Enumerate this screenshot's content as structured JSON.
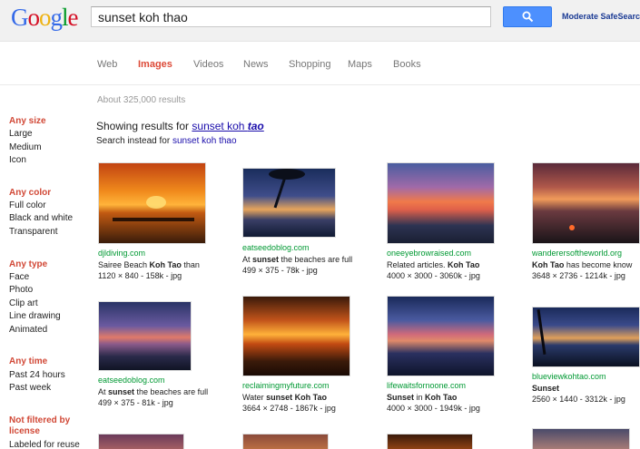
{
  "logo": {
    "letters": [
      "G",
      "o",
      "o",
      "g",
      "l",
      "e"
    ],
    "colors": [
      "#3369e8",
      "#d50f25",
      "#eeb211",
      "#3369e8",
      "#009925",
      "#d50f25"
    ]
  },
  "search": {
    "query": "sunset koh thao"
  },
  "safesearch_label": "Moderate SafeSearch is",
  "tabs": [
    {
      "label": "Web",
      "active": false
    },
    {
      "label": "Images",
      "active": true
    },
    {
      "label": "Videos",
      "active": false
    },
    {
      "label": "News",
      "active": false
    },
    {
      "label": "Shopping",
      "active": false
    },
    {
      "label": "Maps",
      "active": false
    },
    {
      "label": "Books",
      "active": false
    }
  ],
  "result_stats": "About 325,000 results",
  "spelling": {
    "showing_prefix": "Showing results for ",
    "showing_link_a": "sunset koh ",
    "showing_link_b": "tao",
    "instead_prefix": "Search instead for ",
    "instead_link": "sunset koh thao"
  },
  "filters": {
    "size": {
      "heading": "Any size",
      "items": [
        "Large",
        "Medium",
        "Icon"
      ]
    },
    "color": {
      "heading": "Any color",
      "items": [
        "Full color",
        "Black and white",
        "Transparent"
      ]
    },
    "type": {
      "heading": "Any type",
      "items": [
        "Face",
        "Photo",
        "Clip art",
        "Line drawing",
        "Animated"
      ]
    },
    "time": {
      "heading": "Any time",
      "items": [
        "Past 24 hours",
        "Past week"
      ]
    },
    "license": {
      "heading_1": "Not filtered by",
      "heading_2": "license",
      "items": [
        "Labeled for reuse"
      ]
    }
  },
  "results": [
    {
      "cite": "djldiving.com",
      "desc_pre": "Sairee Beach ",
      "desc_bold": "Koh Tao",
      "desc_post": " than",
      "meta": "1120 × 840 - 158k - jpg"
    },
    {
      "cite": "eatseedoblog.com",
      "desc_pre": "At ",
      "desc_bold": "sunset",
      "desc_post": " the beaches are full",
      "meta": "499 × 375 - 78k - jpg"
    },
    {
      "cite": "oneeyebrowraised.com",
      "desc_pre": "Related articles. ",
      "desc_bold": "Koh Tao",
      "desc_post": "",
      "meta": "4000 × 3000 - 3060k - jpg"
    },
    {
      "cite": "wanderersoftheworld.org",
      "desc_pre": "",
      "desc_bold": "Koh Tao",
      "desc_post": " has become know",
      "meta": "3648 × 2736 - 1214k - jpg"
    },
    {
      "cite": "eatseedoblog.com",
      "desc_pre": "At ",
      "desc_bold": "sunset",
      "desc_post": " the beaches are full",
      "meta": "499 × 375 - 81k - jpg"
    },
    {
      "cite": "reclaimingmyfuture.com",
      "desc_pre": "Water ",
      "desc_bold": "sunset Koh Tao",
      "desc_post": "",
      "meta": "3664 × 2748 - 1867k - jpg"
    },
    {
      "cite": "lifewaitsfornoone.com",
      "desc_pre": "",
      "desc_bold": "Sunset",
      "desc_post": " in ",
      "desc_bold2": "Koh Tao",
      "meta": "4000 × 3000 - 1949k - jpg"
    },
    {
      "cite": "blueviewkohtao.com",
      "desc_pre": "",
      "desc_bold": "Sunset",
      "desc_post": "",
      "meta": "2560 × 1440 - 3312k - jpg"
    }
  ],
  "colors": {
    "accent_red": "#dd4b39",
    "link_blue": "#1a0dab",
    "cite_green": "#009933",
    "button_blue": "#4d90fe"
  }
}
